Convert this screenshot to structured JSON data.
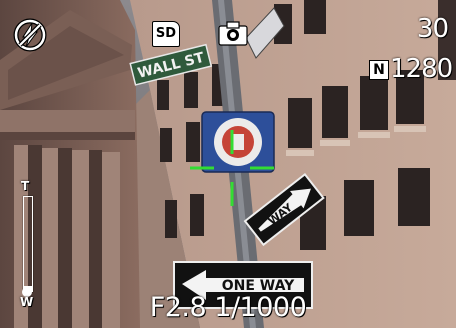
{
  "status": {
    "flash_icon": "flash-off-icon",
    "media_icon": "sd-card-icon",
    "media_label": "SD",
    "mode_icon": "camera-icon",
    "shots_remaining": "30",
    "quality_badge": "N",
    "image_size": "1280"
  },
  "exposure": {
    "readout": "F2.8 1/1000"
  },
  "zoom": {
    "tele_label": "T",
    "wide_label": "W",
    "level": 0.05
  },
  "scene": {
    "signs": {
      "street_sign": "WALL ST",
      "one_way_left": "ONE WAY",
      "one_way_right": "WAY"
    }
  },
  "colors": {
    "osd_text": "#ffffff",
    "af_bracket": "#33dd33"
  }
}
